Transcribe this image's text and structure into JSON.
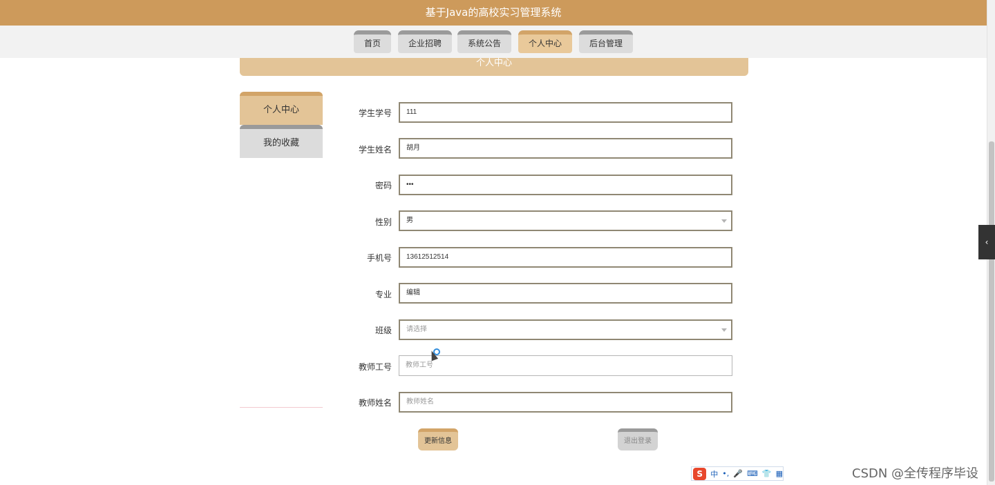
{
  "app": {
    "title": "基于Java的高校实习管理系统"
  },
  "nav": {
    "items": [
      {
        "label": "首页"
      },
      {
        "label": "企业招聘"
      },
      {
        "label": "系统公告"
      },
      {
        "label": "个人中心",
        "active": true
      },
      {
        "label": "后台管理"
      }
    ]
  },
  "page_banner": "个人中心",
  "sidebar": {
    "items": [
      {
        "label": "个人中心",
        "active": true
      },
      {
        "label": "我的收藏"
      }
    ]
  },
  "form": {
    "student_id": {
      "label": "学生学号",
      "value": "111"
    },
    "student_name": {
      "label": "学生姓名",
      "value": "胡月"
    },
    "password": {
      "label": "密码",
      "value": "•••"
    },
    "gender": {
      "label": "性别",
      "value": "男"
    },
    "phone": {
      "label": "手机号",
      "value": "13612512514"
    },
    "major": {
      "label": "专业",
      "value": "编辑"
    },
    "class": {
      "label": "班级",
      "placeholder": "请选择"
    },
    "teacher_id": {
      "label": "教师工号",
      "placeholder": "教师工号"
    },
    "teacher_name": {
      "label": "教师姓名",
      "placeholder": "教师姓名"
    }
  },
  "buttons": {
    "update": "更新信息",
    "logout": "退出登录"
  },
  "ime": {
    "mode": "中"
  },
  "watermark": "CSDN @全传程序毕设",
  "colors": {
    "header": "#cd9a5b",
    "accent": "#e3c497",
    "accent_dark": "#d2a468",
    "inactive_tab": "#dcdcdc"
  }
}
